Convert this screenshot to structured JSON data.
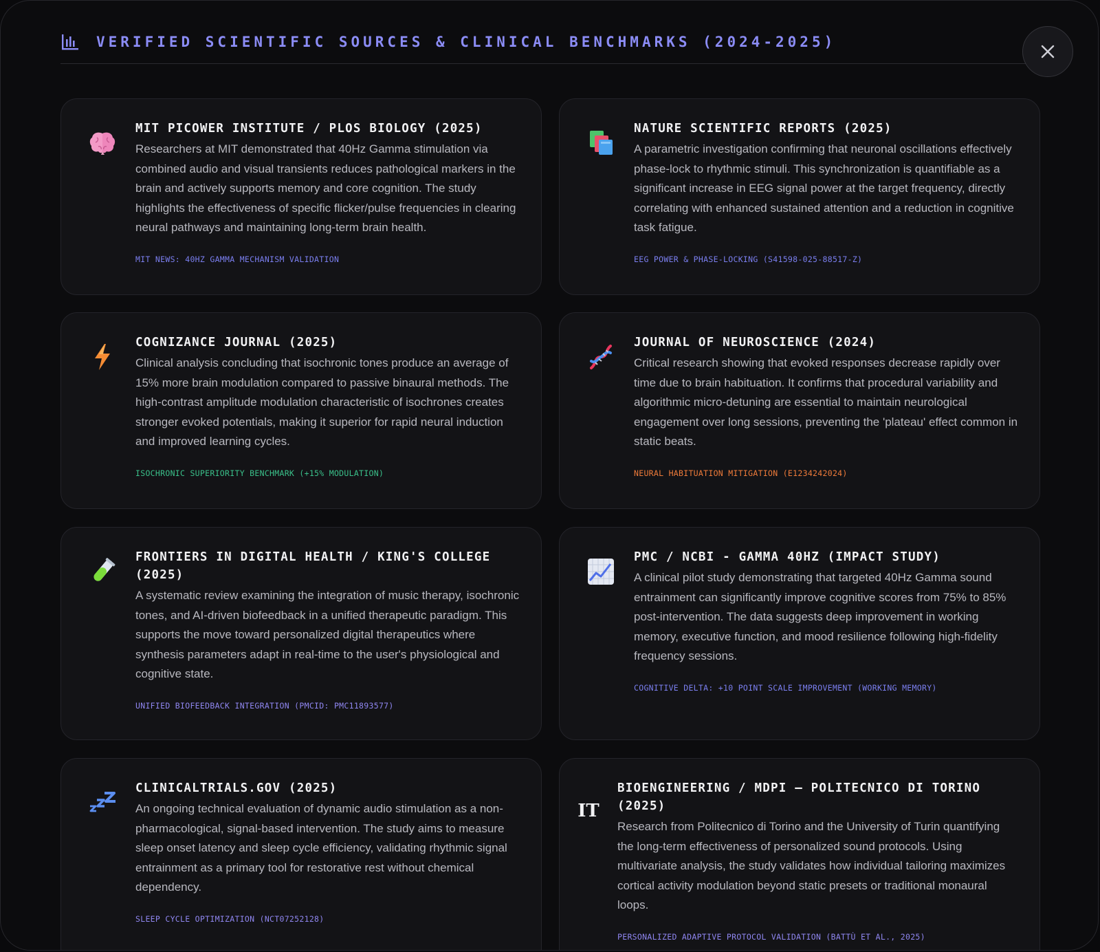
{
  "header": {
    "title": "VERIFIED SCIENTIFIC SOURCES & CLINICAL BENCHMARKS (2024-2025)",
    "icon": "bar-chart-icon"
  },
  "close_button": {
    "icon": "close-icon"
  },
  "cards": [
    {
      "icon": "brain-icon",
      "title": "MIT PICOWER INSTITUTE / PLOS BIOLOGY (2025)",
      "description": "Researchers at MIT demonstrated that 40Hz Gamma stimulation via combined audio and visual transients reduces pathological markers in the brain and actively supports memory and core cognition. The study highlights the effectiveness of specific flicker/pulse frequencies in clearing neural pathways and maintaining long-term brain health.",
      "tag": "MIT NEWS: 40HZ GAMMA MECHANISM VALIDATION",
      "tag_color": "#7b7ff0"
    },
    {
      "icon": "books-icon",
      "title": "NATURE SCIENTIFIC REPORTS (2025)",
      "description": "A parametric investigation confirming that neuronal oscillations effectively phase-lock to rhythmic stimuli. This synchronization is quantifiable as a significant increase in EEG signal power at the target frequency, directly correlating with enhanced sustained attention and a reduction in cognitive task fatigue.",
      "tag": "EEG POWER & PHASE-LOCKING (S41598-025-88517-Z)",
      "tag_color": "#7b7ff0"
    },
    {
      "icon": "lightning-icon",
      "title": "COGNIZANCE JOURNAL (2025)",
      "description": "Clinical analysis concluding that isochronic tones produce an average of 15% more brain modulation compared to passive binaural methods. The high-contrast amplitude modulation characteristic of isochrones creates stronger evoked potentials, making it superior for rapid neural induction and improved learning cycles.",
      "tag": "ISOCHRONIC SUPERIORITY BENCHMARK (+15% MODULATION)",
      "tag_color": "#3ac08a"
    },
    {
      "icon": "dna-icon",
      "title": "JOURNAL OF NEUROSCIENCE (2024)",
      "description": "Critical research showing that evoked responses decrease rapidly over time due to brain habituation. It confirms that procedural variability and algorithmic micro-detuning are essential to maintain neurological engagement over long sessions, preventing the 'plateau' effect common in static beats.",
      "tag": "NEURAL HABITUATION MITIGATION (E1234242024)",
      "tag_color": "#ef7b3a"
    },
    {
      "icon": "test-tube-icon",
      "title": "FRONTIERS IN DIGITAL HEALTH / KING'S COLLEGE (2025)",
      "description": "A systematic review examining the integration of music therapy, isochronic tones, and AI-driven biofeedback in a unified therapeutic paradigm. This supports the move toward personalized digital therapeutics where synthesis parameters adapt in real-time to the user's physiological and cognitive state.",
      "tag": "UNIFIED BIOFEEDBACK INTEGRATION (PMCID: PMC11893577)",
      "tag_color": "#8f86f0"
    },
    {
      "icon": "chart-increasing-icon",
      "title": "PMC / NCBI - GAMMA 40HZ (IMPACT STUDY)",
      "description": "A clinical pilot study demonstrating that targeted 40Hz Gamma sound entrainment can significantly improve cognitive scores from 75% to 85% post-intervention. The data suggests deep improvement in working memory, executive function, and mood resilience following high-fidelity frequency sessions.",
      "tag": "COGNITIVE DELTA: +10 POINT SCALE IMPROVEMENT (WORKING MEMORY)",
      "tag_color": "#7b7ff0"
    },
    {
      "icon": "zzz-icon",
      "title": "CLINICALTRIALS.GOV (2025)",
      "description": "An ongoing technical evaluation of dynamic audio stimulation as a non-pharmacological, signal-based intervention. The study aims to measure sleep onset latency and sleep cycle efficiency, validating rhythmic signal entrainment as a primary tool for restorative rest without chemical dependency.",
      "tag": "SLEEP CYCLE OPTIMIZATION (NCT07252128)",
      "tag_color": "#8f86f0"
    },
    {
      "icon": "it-icon",
      "icon_text": "IT",
      "title": "BIOENGINEERING / MDPI — POLITECNICO DI TORINO (2025)",
      "description": "Research from Politecnico di Torino and the University of Turin quantifying the long-term effectiveness of personalized sound protocols. Using multivariate analysis, the study validates how individual tailoring maximizes cortical activity modulation beyond static presets or traditional monaural loops.",
      "tag": "PERSONALIZED ADAPTIVE PROTOCOL VALIDATION (BATTÙ ET AL., 2025)",
      "tag_color": "#8f86f0"
    }
  ]
}
